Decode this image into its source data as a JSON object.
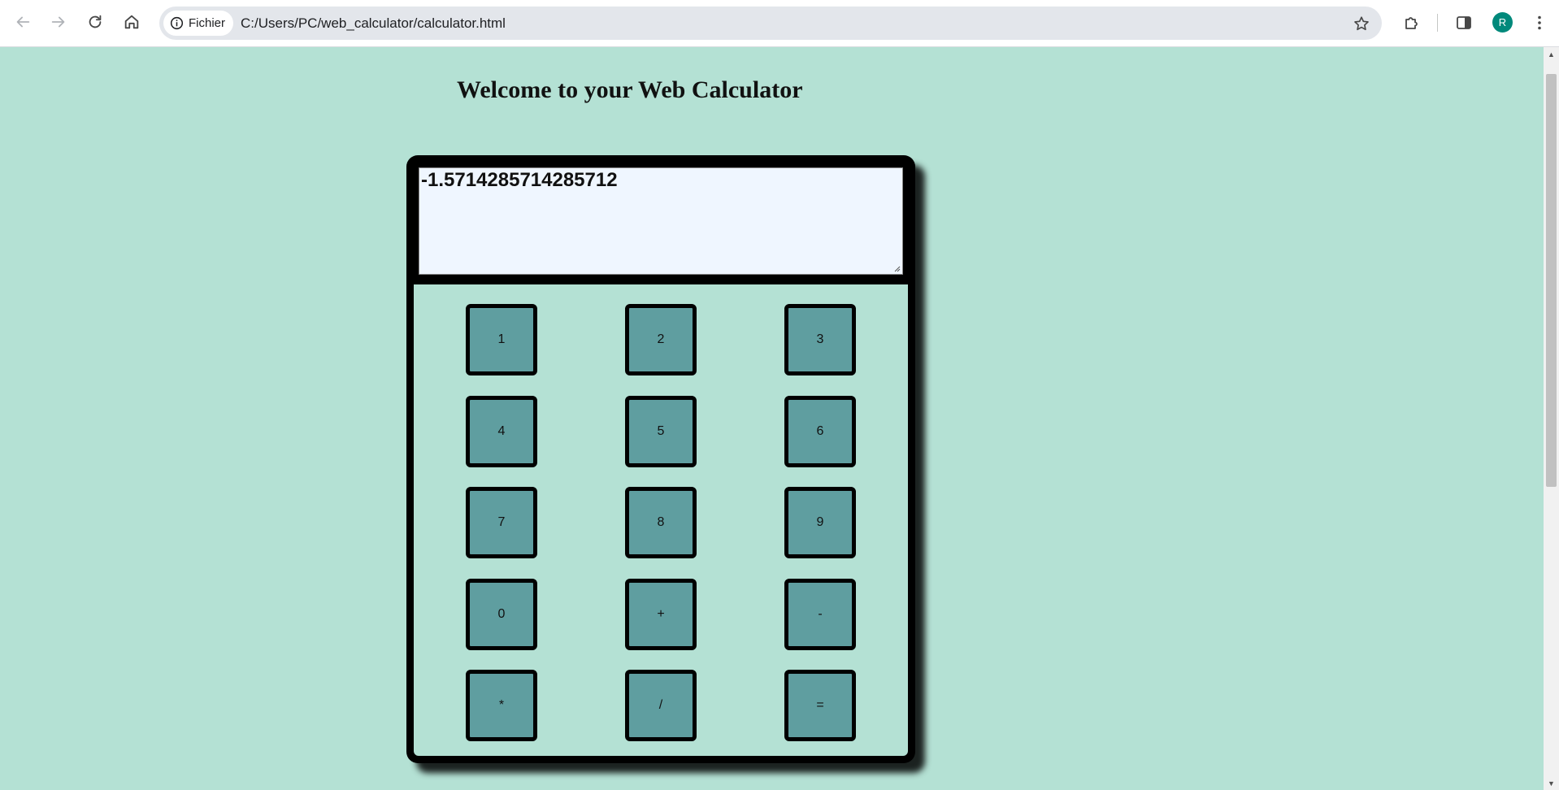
{
  "browser": {
    "site_chip_label": "Fichier",
    "url": "C:/Users/PC/web_calculator/calculator.html",
    "profile_initial": "R",
    "profile_color": "#00897b"
  },
  "page": {
    "title": "Welcome to your Web Calculator",
    "background_color": "#b4e1d4"
  },
  "calculator": {
    "display_value": "-1.5714285714285712",
    "button_color": "#5f9ea0",
    "keys": [
      "1",
      "2",
      "3",
      "4",
      "5",
      "6",
      "7",
      "8",
      "9",
      "0",
      "+",
      "-",
      "*",
      "/",
      "="
    ]
  }
}
